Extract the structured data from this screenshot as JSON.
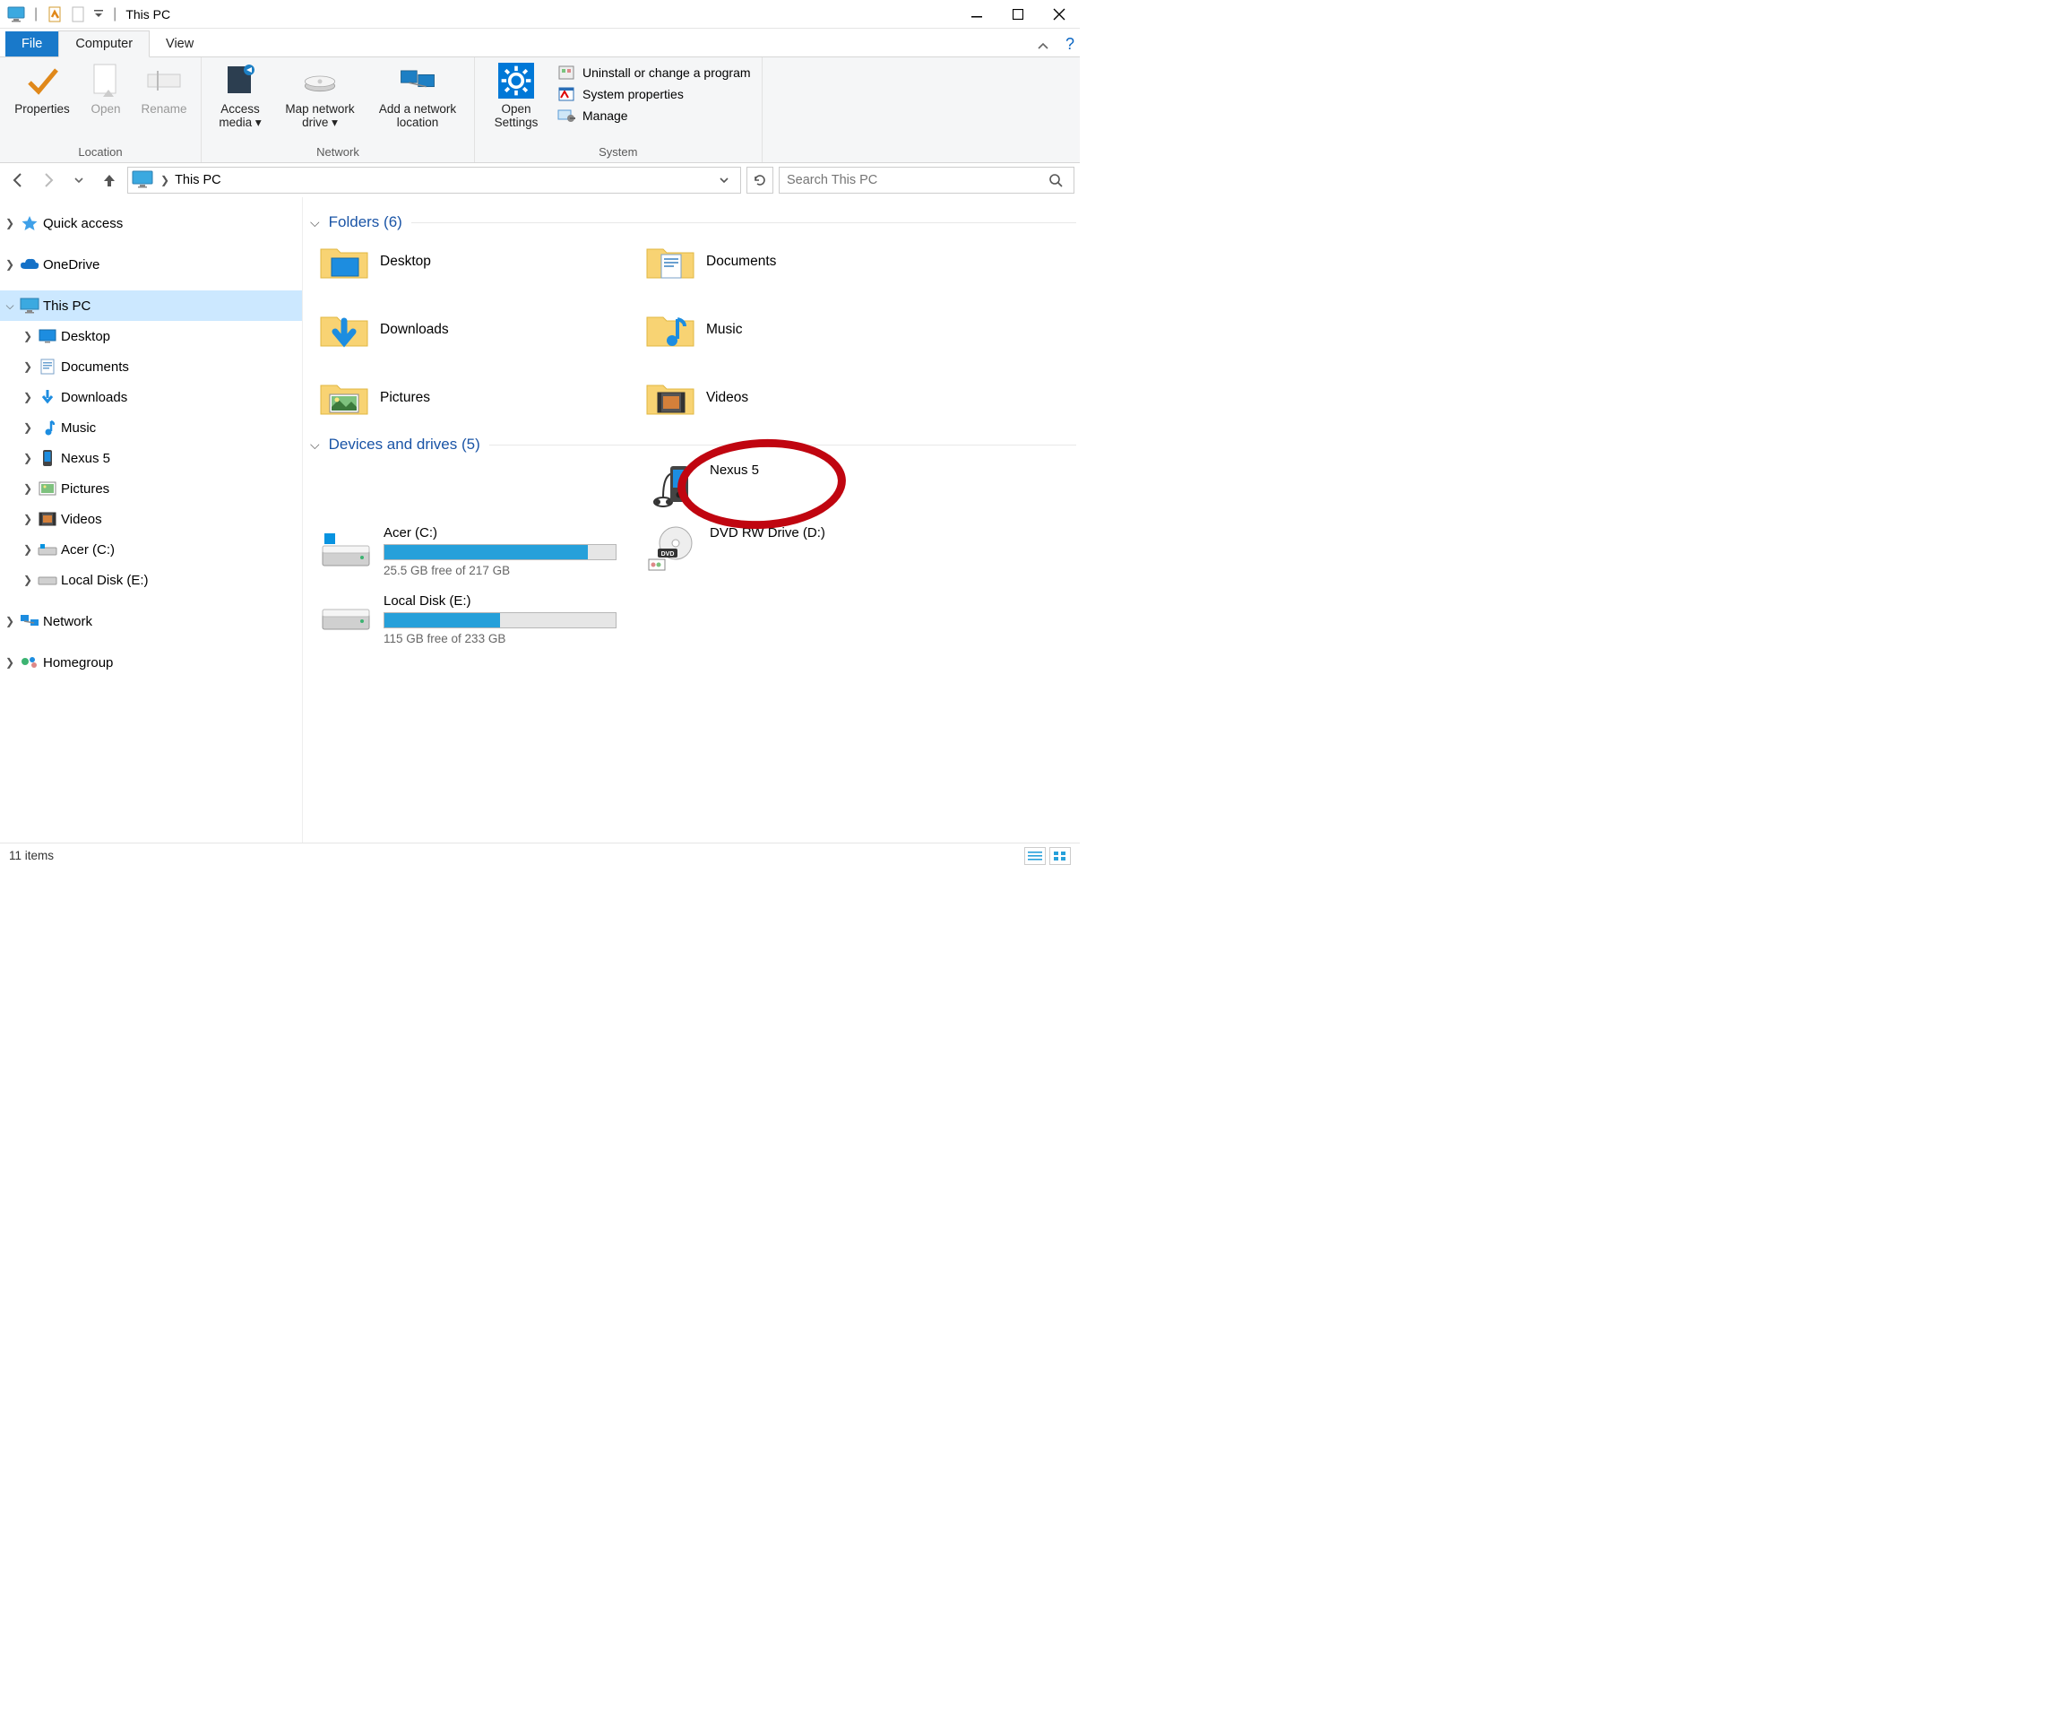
{
  "window": {
    "title": "This PC"
  },
  "tabs": {
    "file": "File",
    "computer": "Computer",
    "view": "View"
  },
  "ribbon": {
    "location": {
      "title": "Location",
      "properties": "Properties",
      "open": "Open",
      "rename": "Rename"
    },
    "network": {
      "title": "Network",
      "access_media": "Access media ▾",
      "map_drive": "Map network drive ▾",
      "add_location": "Add a network location"
    },
    "system": {
      "title": "System",
      "open_settings": "Open Settings",
      "uninstall": "Uninstall or change a program",
      "properties": "System properties",
      "manage": "Manage"
    }
  },
  "address": {
    "crumb1": "This PC"
  },
  "search": {
    "placeholder": "Search This PC"
  },
  "tree": {
    "quick_access": "Quick access",
    "onedrive": "OneDrive",
    "this_pc": "This PC",
    "desktop": "Desktop",
    "documents": "Documents",
    "downloads": "Downloads",
    "music": "Music",
    "nexus5": "Nexus 5",
    "pictures": "Pictures",
    "videos": "Videos",
    "acer_c": "Acer (C:)",
    "local_e": "Local Disk (E:)",
    "network": "Network",
    "homegroup": "Homegroup"
  },
  "groups": {
    "folders_header": "Folders (6)",
    "devices_header": "Devices and drives (5)"
  },
  "folders": {
    "desktop": "Desktop",
    "documents": "Documents",
    "downloads": "Downloads",
    "music": "Music",
    "pictures": "Pictures",
    "videos": "Videos"
  },
  "devices": {
    "nexus5": "Nexus 5",
    "acer_c": {
      "name": "Acer (C:)",
      "free": "25.5 GB free of 217 GB",
      "fill_pct": 88
    },
    "dvd": "DVD RW Drive (D:)",
    "local_e": {
      "name": "Local Disk (E:)",
      "free": "115 GB free of 233 GB",
      "fill_pct": 50
    }
  },
  "status": {
    "items": "11 items"
  }
}
